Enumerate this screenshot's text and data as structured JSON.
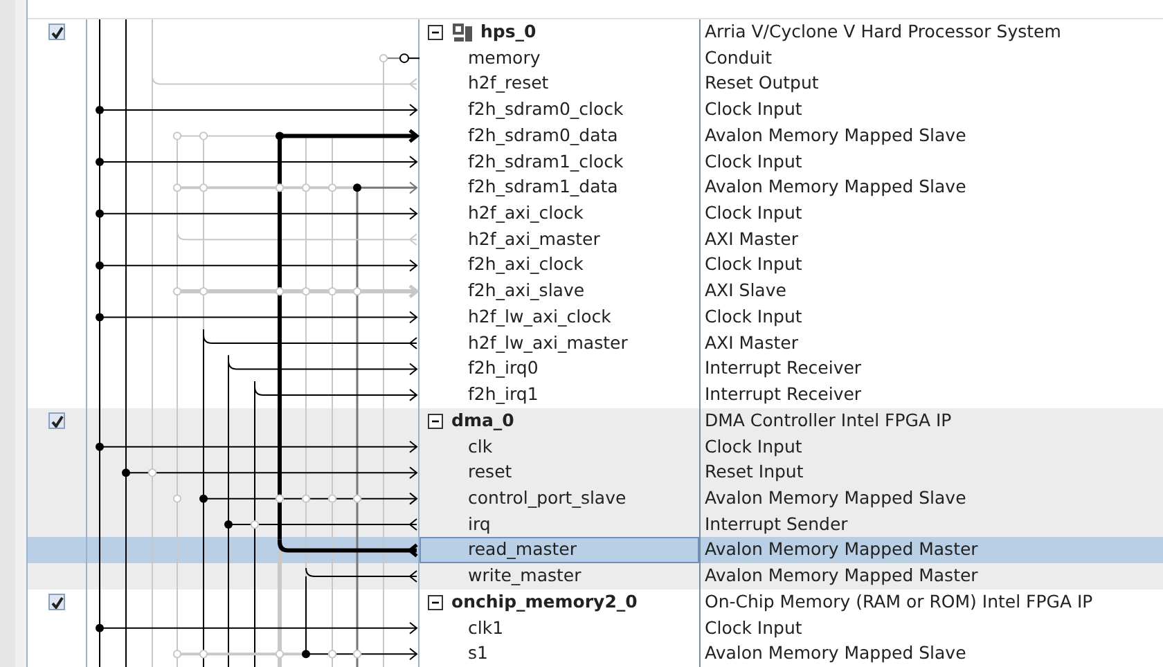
{
  "modules": [
    {
      "name": "hps_0",
      "description": "Arria V/Cyclone V Hard Processor System",
      "kind": "processor",
      "use": true,
      "expanded": true,
      "interfaces": [
        {
          "name": "memory",
          "description": "Conduit",
          "selected": false
        },
        {
          "name": "h2f_reset",
          "description": "Reset Output",
          "selected": false
        },
        {
          "name": "f2h_sdram0_clock",
          "description": "Clock Input",
          "selected": false
        },
        {
          "name": "f2h_sdram0_data",
          "description": "Avalon Memory Mapped Slave",
          "selected": false
        },
        {
          "name": "f2h_sdram1_clock",
          "description": "Clock Input",
          "selected": false
        },
        {
          "name": "f2h_sdram1_data",
          "description": "Avalon Memory Mapped Slave",
          "selected": false
        },
        {
          "name": "h2f_axi_clock",
          "description": "Clock Input",
          "selected": false
        },
        {
          "name": "h2f_axi_master",
          "description": "AXI Master",
          "selected": false
        },
        {
          "name": "f2h_axi_clock",
          "description": "Clock Input",
          "selected": false
        },
        {
          "name": "f2h_axi_slave",
          "description": "AXI Slave",
          "selected": false
        },
        {
          "name": "h2f_lw_axi_clock",
          "description": "Clock Input",
          "selected": false
        },
        {
          "name": "h2f_lw_axi_master",
          "description": "AXI Master",
          "selected": false
        },
        {
          "name": "f2h_irq0",
          "description": "Interrupt Receiver",
          "selected": false
        },
        {
          "name": "f2h_irq1",
          "description": "Interrupt Receiver",
          "selected": false
        }
      ]
    },
    {
      "name": "dma_0",
      "description": "DMA Controller Intel FPGA IP",
      "kind": "component",
      "use": true,
      "expanded": true,
      "interfaces": [
        {
          "name": "clk",
          "description": "Clock Input",
          "selected": false
        },
        {
          "name": "reset",
          "description": "Reset Input",
          "selected": false
        },
        {
          "name": "control_port_slave",
          "description": "Avalon Memory Mapped Slave",
          "selected": false
        },
        {
          "name": "irq",
          "description": "Interrupt Sender",
          "selected": false
        },
        {
          "name": "read_master",
          "description": "Avalon Memory Mapped Master",
          "selected": true
        },
        {
          "name": "write_master",
          "description": "Avalon Memory Mapped Master",
          "selected": false
        }
      ]
    },
    {
      "name": "onchip_memory2_0",
      "description": "On-Chip Memory (RAM or ROM) Intel FPGA IP",
      "kind": "component",
      "use": true,
      "expanded": true,
      "interfaces": [
        {
          "name": "clk1",
          "description": "Clock Input",
          "selected": false
        },
        {
          "name": "s1",
          "description": "Avalon Memory Mapped Slave",
          "selected": false
        }
      ]
    }
  ]
}
